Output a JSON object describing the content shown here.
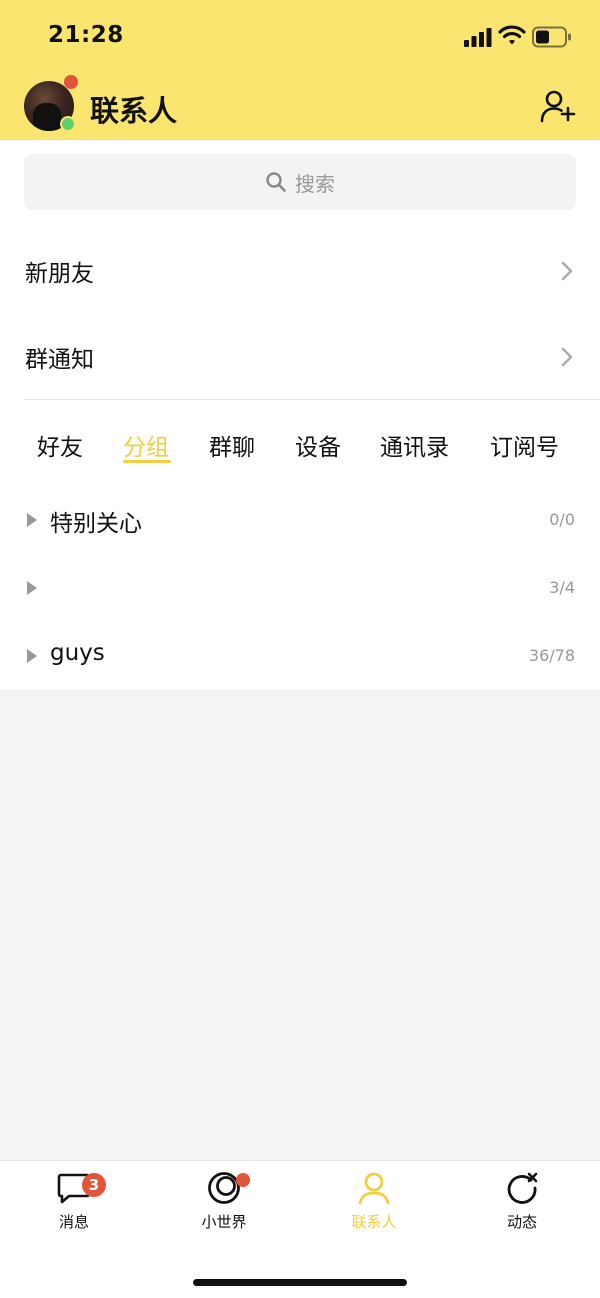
{
  "status_bar": {
    "time": "21:28"
  },
  "header": {
    "title": "联系人",
    "add_icon": "add-contact-icon"
  },
  "search": {
    "placeholder": "搜索",
    "icon": "search-icon"
  },
  "menu_rows": [
    {
      "label": "新朋友"
    },
    {
      "label": "群通知"
    }
  ],
  "tabs": [
    {
      "label": "好友",
      "active": false
    },
    {
      "label": "分组",
      "active": true
    },
    {
      "label": "群聊",
      "active": false
    },
    {
      "label": "设备",
      "active": false
    },
    {
      "label": "通讯录",
      "active": false
    },
    {
      "label": "订阅号",
      "active": false
    }
  ],
  "groups": [
    {
      "name": "特别关心",
      "count": "0/0"
    },
    {
      "name": "",
      "count": "3/4"
    },
    {
      "name": "guys",
      "count": "36/78"
    }
  ],
  "bottom_nav": [
    {
      "label": "消息",
      "icon": "message-icon",
      "badge": "3",
      "active": false
    },
    {
      "label": "小世界",
      "icon": "small-world-icon",
      "dot": true,
      "active": false
    },
    {
      "label": "联系人",
      "icon": "contacts-icon",
      "active": true
    },
    {
      "label": "动态",
      "icon": "moments-icon",
      "active": false
    }
  ],
  "colors": {
    "header_bg": "#fae570",
    "accent": "#f2cf3f",
    "badge": "#e0553b"
  }
}
